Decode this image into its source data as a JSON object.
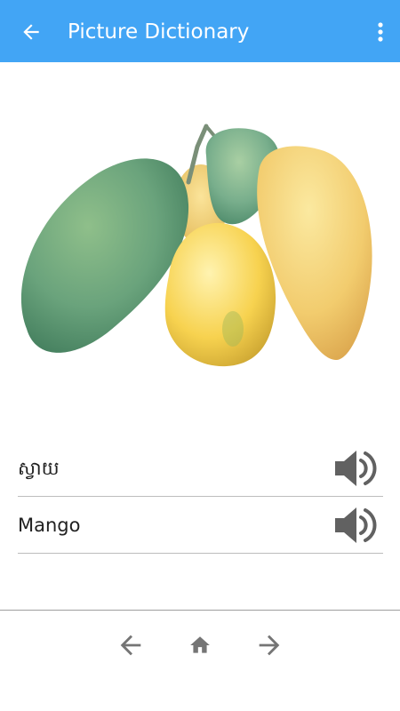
{
  "app_bar": {
    "title": "Picture Dictionary",
    "back_icon": "arrow-left-icon",
    "menu_icon": "more-vertical-icon",
    "background_color": "#42a5f5"
  },
  "picture": {
    "subject_icon": "mango-picture"
  },
  "words": [
    {
      "text": "ស្វាយ",
      "icon": "speaker-icon"
    },
    {
      "text": "Mango",
      "icon": "speaker-icon"
    }
  ],
  "bottom_nav": {
    "prev_icon": "arrow-left-icon",
    "home_icon": "home-icon",
    "next_icon": "arrow-right-icon",
    "icon_color": "#757575"
  }
}
